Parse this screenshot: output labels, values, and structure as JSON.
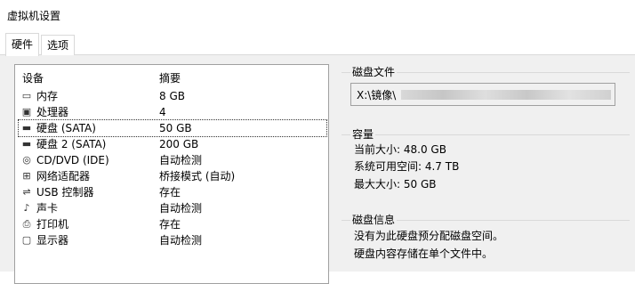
{
  "window": {
    "title": "虚拟机设置"
  },
  "tabs": [
    {
      "label": "硬件",
      "active": true
    },
    {
      "label": "选项",
      "active": false
    }
  ],
  "device_list": {
    "col_device": "设备",
    "col_summary": "摘要",
    "items": [
      {
        "icon": "memory-icon",
        "name": "内存",
        "summary": "8 GB"
      },
      {
        "icon": "cpu-icon",
        "name": "处理器",
        "summary": "4"
      },
      {
        "icon": "hard-disk-icon",
        "name": "硬盘 (SATA)",
        "summary": "50 GB",
        "selected": true
      },
      {
        "icon": "hard-disk-icon",
        "name": "硬盘 2 (SATA)",
        "summary": "200 GB"
      },
      {
        "icon": "cd-dvd-icon",
        "name": "CD/DVD (IDE)",
        "summary": "自动检测"
      },
      {
        "icon": "network-adapter-icon",
        "name": "网络适配器",
        "summary": "桥接模式 (自动)"
      },
      {
        "icon": "usb-icon",
        "name": "USB 控制器",
        "summary": "存在"
      },
      {
        "icon": "sound-icon",
        "name": "声卡",
        "summary": "自动检测"
      },
      {
        "icon": "printer-icon",
        "name": "打印机",
        "summary": "存在"
      },
      {
        "icon": "display-icon",
        "name": "显示器",
        "summary": "自动检测"
      }
    ]
  },
  "disk_file": {
    "title": "磁盘文件",
    "path_prefix": "X:\\镜像\\"
  },
  "capacity": {
    "title": "容量",
    "current_size": "当前大小: 48.0 GB",
    "system_free": "系统可用空间: 4.7 TB",
    "max_size": "最大大小: 50 GB"
  },
  "disk_info": {
    "title": "磁盘信息",
    "line1": "没有为此硬盘预分配磁盘空间。",
    "line2": "硬盘内容存储在单个文件中。"
  }
}
